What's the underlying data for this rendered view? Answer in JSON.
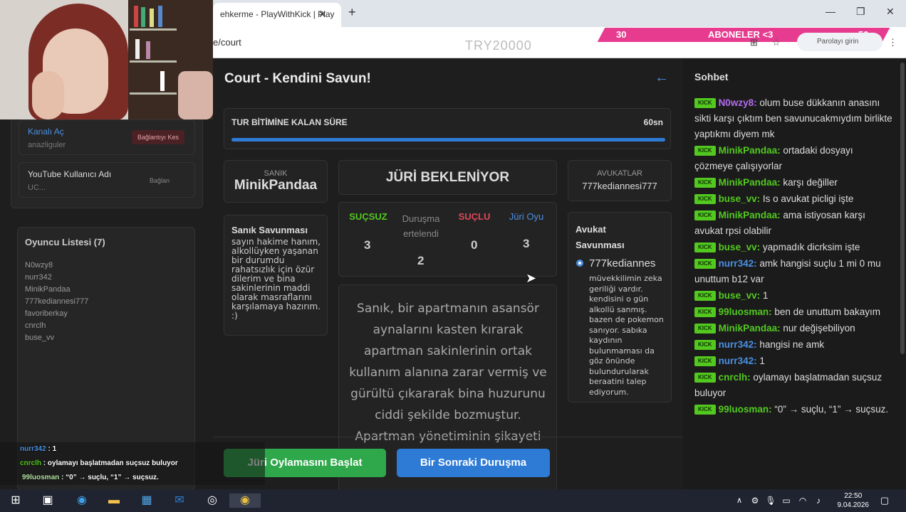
{
  "browser": {
    "tab_title": "ehkerme - PlayWithKick | Play",
    "url": "e/court",
    "promo_code": "TRY20000",
    "sub_left": "30",
    "sub_label": "ABONELER <3",
    "sub_right": "50",
    "password_btn": "Parolayı girin"
  },
  "left": {
    "channel_label": "Kanalı Aç",
    "channel_user": "anazliguler",
    "disconnect_btn": "Bağlantıyı Kes",
    "youtube_label": "YouTube Kullanıcı Adı",
    "youtube_placeholder": "UC...",
    "connect_btn": "Bağlan",
    "players_title": "Oyuncu Listesi (7)",
    "players": [
      "N0wzy8",
      "nurr342",
      "MinikPandaa",
      "777kediannesi777",
      "favoriberkay",
      "cnrclh",
      "buse_vv"
    ]
  },
  "court": {
    "title": "Court - Kendini Savun!",
    "timer_label": "TUR BİTİMİNE KALAN SÜRE",
    "timer_value": "60sn",
    "timer_progress": 1.0,
    "defendant_cap": "SANIK",
    "defendant_name": "MinikPandaa",
    "status": "JÜRİ BEKLENİYOR",
    "lawyers_cap": "AVUKATLAR",
    "lawyer_name": "777kediannesi777",
    "defense_title": "Sanık Savunması",
    "defense_text": "sayın hakime hanım, alkollüyken yaşanan bir durumdu rahatsızlık için özür dilerim ve bina sakinlerinin maddi olarak masraflarını karşılamaya hazırım. :)",
    "verdicts": {
      "innocent_label": "SUÇSUZ",
      "innocent_count": "3",
      "postponed_label": "Duruşma ertelendi",
      "postponed_count": "2",
      "guilty_label": "SUÇLU",
      "guilty_count": "0",
      "jury_label": "Jüri Oyu",
      "jury_count": "3"
    },
    "case_text": "Sanık, bir apartmanın asansör aynalarını kasten kırarak apartman sakinlerinin ortak kullanım alanına zarar vermiş ve gürültü çıkararak bina huzurunu ciddi şekilde bozmuştur. Apartman yönetiminin şikayeti ve",
    "lawyer_defense_title": "Avukat Savunması",
    "lawyer_defense_name": "777kediannes",
    "lawyer_defense_text": "müvekkilimin zeka geriliği vardır. kendisini o gün alkollü sanmış. bazen de pokemon sanıyor. sabıka kaydının bulunmaması da göz önünde bulundurularak beraatini talep ediyorum.",
    "start_btn": "Jüri Oylamasını Başlat",
    "next_btn": "Bir Sonraki Duruşma"
  },
  "chat": {
    "title": "Sohbet",
    "badge": "KICK",
    "messages": [
      {
        "user": "N0wzy8:",
        "text": "olum buse dükkanın anasını sikti karşı çıktım ben savunucakmıydım birlikte yaptıkmı diyem mk",
        "color": "#b36cf0"
      },
      {
        "user": "MinikPandaa:",
        "text": "ortadaki dosyayı çözmeye çalışıyorlar",
        "color": "#53c920"
      },
      {
        "user": "MinikPandaa:",
        "text": "karşı değiller",
        "color": "#53c920"
      },
      {
        "user": "buse_vv:",
        "text": "Is o avukat picligi işte",
        "color": "#53c920"
      },
      {
        "user": "MinikPandaa:",
        "text": "ama istiyosan karşı avukat rpsi olabilir",
        "color": "#53c920"
      },
      {
        "user": "buse_vv:",
        "text": "yapmadık dicrksim işte",
        "color": "#53c920"
      },
      {
        "user": "nurr342:",
        "text": "amk hangisi suçlu 1 mi 0 mu unuttum b12 var",
        "color": "#4a90e2"
      },
      {
        "user": "buse_vv:",
        "text": "1",
        "color": "#53c920"
      },
      {
        "user": "99luosman:",
        "text": "ben de unuttum bakayım",
        "color": "#53c920"
      },
      {
        "user": "MinikPandaa:",
        "text": "nur değişebiliyon",
        "color": "#53c920"
      },
      {
        "user": "nurr342:",
        "text": "hangisi ne amk",
        "color": "#4a90e2"
      },
      {
        "user": "nurr342:",
        "text": "1",
        "color": "#4a90e2"
      },
      {
        "user": "cnrclh:",
        "text": "oylamayı başlatmadan suçsuz buluyor",
        "color": "#53c920"
      },
      {
        "user": "99luosman:",
        "text": "“0” → suçlu, “1” → suçsuz.",
        "color": "#53c920"
      }
    ]
  },
  "overlay": {
    "line1_user": "nurr342",
    "line1_text": ": 1",
    "line2_user": "cnrclh",
    "line2_text": ": oylamayı başlatmadan suçsuz buluyor",
    "line3_user": "99luosman",
    "line3_text": ": “0” → suçlu, “1” → suçsuz."
  },
  "taskbar": {
    "time": "22:50",
    "date": "9.04.2026"
  }
}
